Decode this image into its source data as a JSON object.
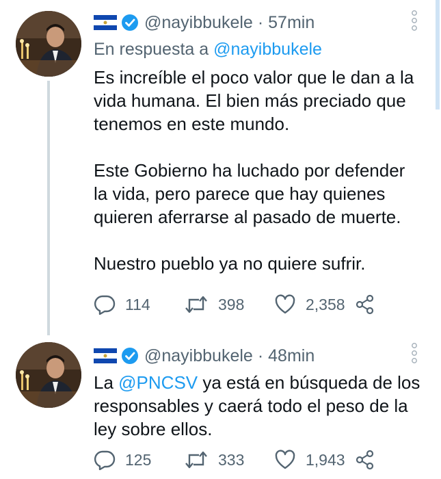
{
  "tweets": [
    {
      "handle": "@nayibbukele",
      "separator": "·",
      "time": "57min",
      "reply_prefix": "En respuesta a ",
      "reply_handle": "@nayibbukele",
      "body": "Es increíble el poco valor que le dan a la\nvida humana. El bien más preciado que\ntenemos en este mundo.\n\nEste Gobierno ha luchado por defender\nla vida, pero parece que hay quienes\nquieren aferrarse al pasado de muerte.\n\nNuestro pueblo ya no quiere sufrir.",
      "replies": "114",
      "retweets": "398",
      "likes": "2,358"
    },
    {
      "handle": "@nayibbukele",
      "separator": "·",
      "time": "48min",
      "body_prefix": "La ",
      "mention": "@PNCSV",
      "body_rest": " ya está en búsqueda de los\nresponsables y caerá todo el peso de la\nley sobre ellos.",
      "replies": "125",
      "retweets": "333",
      "likes": "1,943"
    }
  ],
  "icons": {
    "flag": "el-salvador-flag-icon",
    "verified": "verified-badge-icon",
    "more": "more-options-icon",
    "reply": "reply-icon",
    "retweet": "retweet-icon",
    "like": "heart-icon",
    "share": "share-icon"
  },
  "colors": {
    "accent": "#1d9bf0",
    "secondary_text": "#536471",
    "flag_blue": "#0f47af",
    "thread_line": "#cfd9de"
  }
}
